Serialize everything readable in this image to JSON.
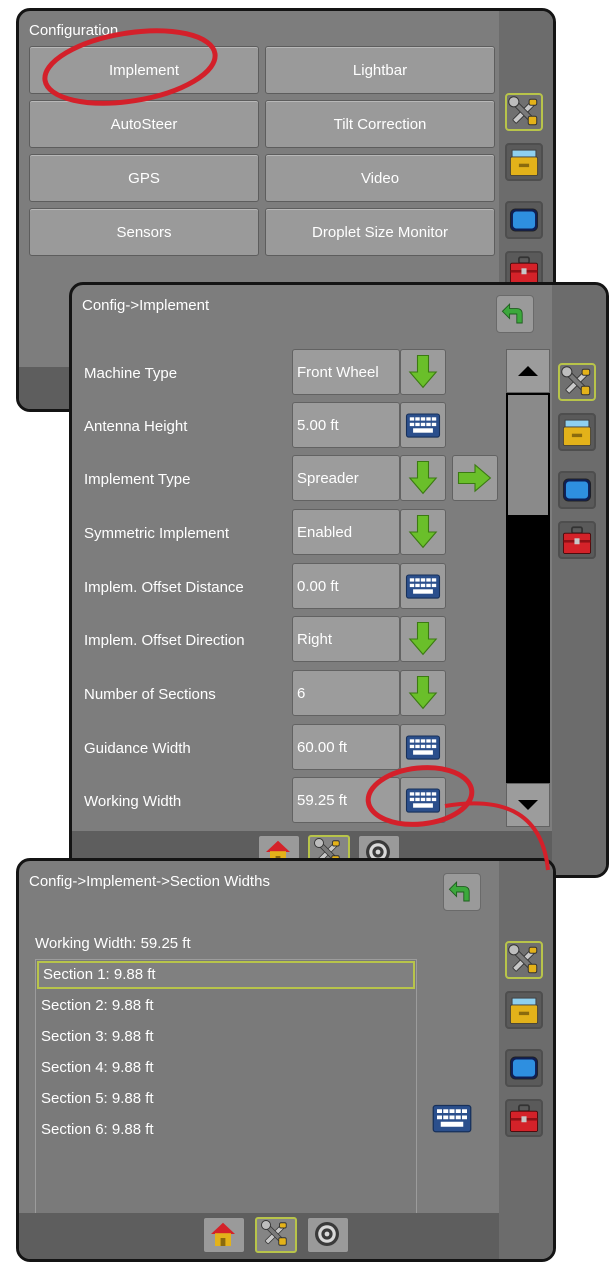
{
  "panel1": {
    "title": "Configuration",
    "buttons": [
      {
        "label": "Implement"
      },
      {
        "label": "Lightbar"
      },
      {
        "label": "AutoSteer"
      },
      {
        "label": "Tilt Correction"
      },
      {
        "label": "GPS"
      },
      {
        "label": "Video"
      },
      {
        "label": "Sensors"
      },
      {
        "label": "Droplet Size Monitor"
      }
    ]
  },
  "panel2": {
    "title": "Config->Implement",
    "rows": [
      {
        "label": "Machine Type",
        "value": "Front Wheel",
        "action": "dropdown"
      },
      {
        "label": "Antenna Height",
        "value": "5.00 ft",
        "action": "keyboard"
      },
      {
        "label": "Implement Type",
        "value": "Spreader",
        "action": "dropdown"
      },
      {
        "label": "Symmetric Implement",
        "value": "Enabled",
        "action": "dropdown"
      },
      {
        "label": "Implem. Offset Distance",
        "value": "0.00 ft",
        "action": "keyboard"
      },
      {
        "label": "Implem. Offset Direction",
        "value": "Right",
        "action": "dropdown"
      },
      {
        "label": "Number of Sections",
        "value": "6",
        "action": "dropdown"
      },
      {
        "label": "Guidance Width",
        "value": "60.00 ft",
        "action": "keyboard"
      },
      {
        "label": "Working Width",
        "value": "59.25 ft",
        "action": "keyboard"
      }
    ]
  },
  "panel3": {
    "title": "Config->Implement->Section Widths",
    "working_width": "Working Width: 59.25 ft",
    "sections": [
      {
        "label": "Section 1: 9.88 ft"
      },
      {
        "label": "Section 2: 9.88 ft"
      },
      {
        "label": "Section 3: 9.88 ft"
      },
      {
        "label": "Section 4: 9.88 ft"
      },
      {
        "label": "Section 5: 9.88 ft"
      },
      {
        "label": "Section 6: 9.88 ft"
      }
    ]
  },
  "icons": {
    "sidebar": [
      "tools-icon",
      "file-folder-icon",
      "display-icon",
      "toolbox-icon"
    ],
    "bottom": [
      "home-icon",
      "tools-icon",
      "target-icon"
    ],
    "back": "back-arrow-icon",
    "dropdown": "down-arrow-icon",
    "keyboard": "keyboard-icon",
    "next": "right-arrow-icon"
  },
  "colors": {
    "panel": "#7d7d7d",
    "highlight": "#b8c44a",
    "annotation": "#d4202a",
    "arrow_green": "#6abf2a"
  }
}
